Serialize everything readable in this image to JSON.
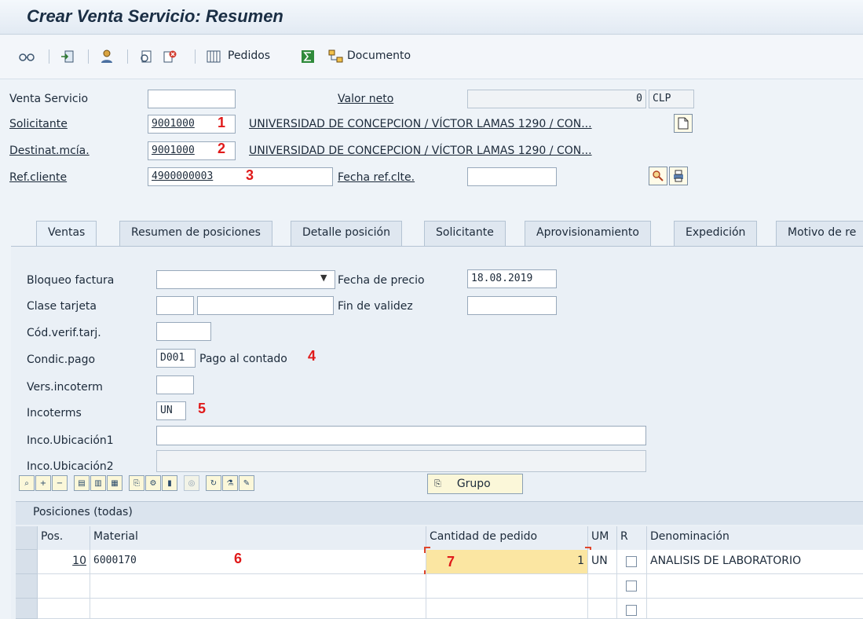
{
  "title": "Crear Venta Servicio: Resumen",
  "toolbar": {
    "icons": [
      "glasses-icon",
      "import-icon",
      "person-icon",
      "display-doc-icon",
      "delete-doc-icon",
      "orders-icon",
      "sum-icon",
      "document-flow-icon"
    ],
    "pedidos_label": "Pedidos",
    "documento_label": "Documento"
  },
  "header": {
    "venta_servicio_label": "Venta Servicio",
    "venta_servicio_value": "",
    "valor_neto_label": "Valor neto",
    "valor_neto_value": "0",
    "currency": "CLP",
    "solicitante_label": "Solicitante",
    "solicitante_value": "9001000",
    "solicitante_desc": "UNIVERSIDAD DE CONCEPCION / VÍCTOR LAMAS 1290 / CON...",
    "destinat_label": "Destinat.mcía.",
    "destinat_value": "9001000",
    "destinat_desc": "UNIVERSIDAD DE CONCEPCION / VÍCTOR LAMAS 1290 / CON...",
    "refcliente_label": "Ref.cliente",
    "refcliente_value": "4900000003",
    "fecha_ref_label": "Fecha ref.clte.",
    "fecha_ref_value": ""
  },
  "annotations": [
    "1",
    "2",
    "3",
    "4",
    "5",
    "6",
    "7"
  ],
  "tabs": [
    "Ventas",
    "Resumen de posiciones",
    "Detalle posición",
    "Solicitante",
    "Aprovisionamiento",
    "Expedición",
    "Motivo de re"
  ],
  "ventas": {
    "bloqueo_factura_label": "Bloqueo factura",
    "bloqueo_factura_value": "",
    "fecha_precio_label": "Fecha de precio",
    "fecha_precio_value": "18.08.2019",
    "clase_tarjeta_label": "Clase tarjeta",
    "fin_validez_label": "Fin de validez",
    "cod_verif_label": "Cód.verif.tarj.",
    "condic_pago_label": "Condic.pago",
    "condic_pago_value": "D001",
    "condic_pago_desc": "Pago al contado",
    "vers_incoterm_label": "Vers.incoterm",
    "incoterms_label": "Incoterms",
    "incoterms_value": "UN",
    "inco_ubic1_label": "Inco.Ubicación1",
    "inco_ubic2_label": "Inco.Ubicación2"
  },
  "grid": {
    "grupo_label": "Grupo",
    "title": "Posiciones (todas)",
    "columns": [
      "Pos.",
      "Material",
      "Cantidad de pedido",
      "UM",
      "R",
      "Denominación"
    ],
    "rows": [
      {
        "pos": "10",
        "material": "6000170",
        "cantidad": "1",
        "um": "UN",
        "denominacion": "ANALISIS DE LABORATORIO"
      },
      {
        "pos": "",
        "material": "",
        "cantidad": "",
        "um": "",
        "denominacion": ""
      },
      {
        "pos": "",
        "material": "",
        "cantidad": "",
        "um": "",
        "denominacion": ""
      }
    ]
  }
}
